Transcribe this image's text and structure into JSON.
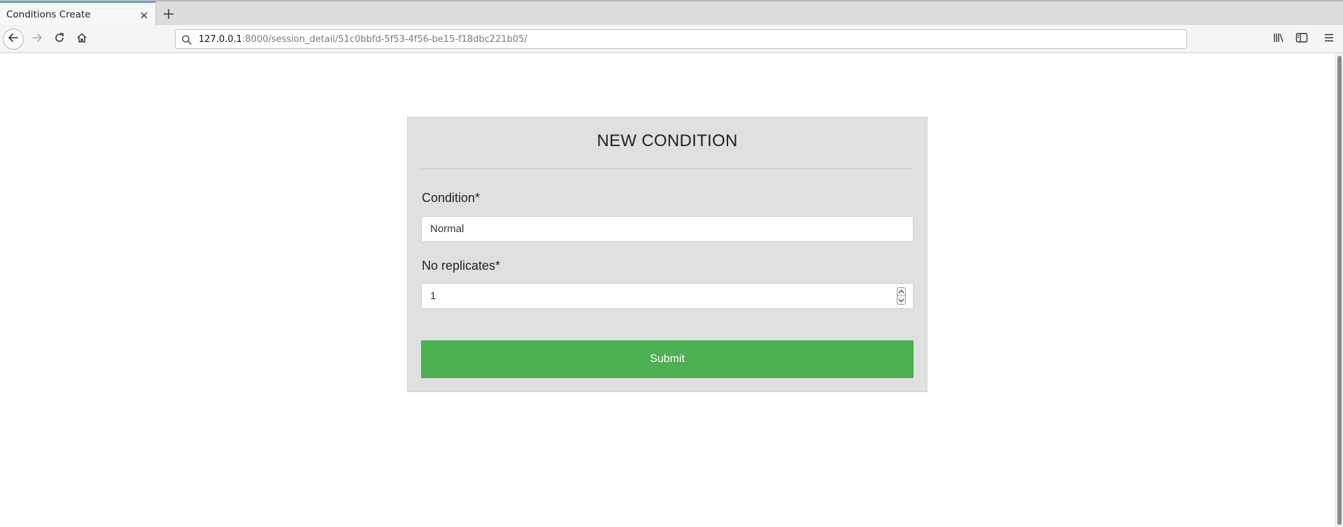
{
  "browser": {
    "tab": {
      "title": "Conditions Create"
    },
    "url": {
      "host": "127.0.0.1",
      "path": ":8000/session_detail/51c0bbfd-5f53-4f56-be15-f18dbc221b05/"
    },
    "icons": [
      "back-arrow-icon",
      "forward-arrow-icon",
      "reload-icon",
      "home-icon",
      "search-icon",
      "library-icon",
      "sidebar-icon",
      "hamburger-menu-icon",
      "close-icon",
      "plus-icon"
    ]
  },
  "form": {
    "title": "NEW CONDITION",
    "condition": {
      "label": "Condition*",
      "value": "Normal"
    },
    "replicates": {
      "label": "No replicates*",
      "value": "1"
    },
    "submit_label": "Submit"
  },
  "colors": {
    "card_background": "#dfe0e0",
    "submit_button": "#4caf50",
    "tab_accent": "#4a90d9"
  }
}
